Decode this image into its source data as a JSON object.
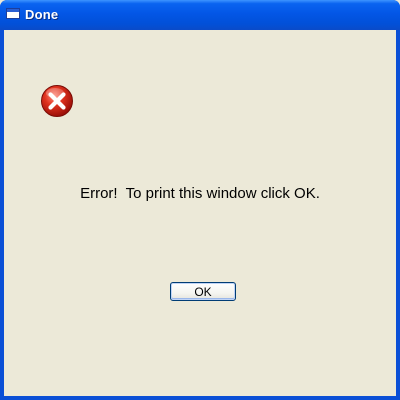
{
  "window": {
    "title": "Done",
    "icon": "window-icon"
  },
  "dialog": {
    "icon": "error-icon",
    "message": "Error!  To print this window click OK.",
    "ok_label": "OK"
  },
  "colors": {
    "titlebar": "#0356e6",
    "background": "#ece9d8",
    "error_red": "#d8221b"
  }
}
